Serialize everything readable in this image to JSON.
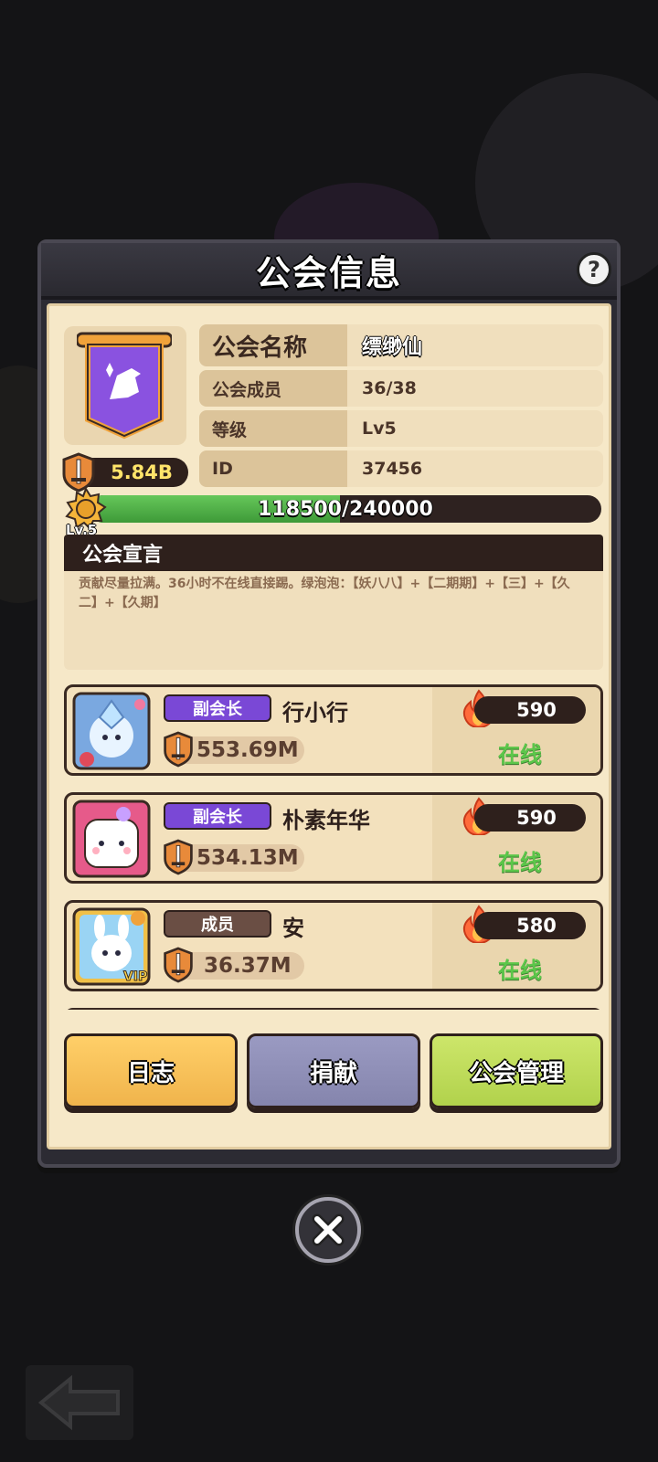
{
  "dialog": {
    "title": "公会信息",
    "help_icon": "help-icon",
    "help_label": "?"
  },
  "guild": {
    "power": "5.84B",
    "fields": [
      {
        "label": "公会名称",
        "value": "缥缈仙"
      },
      {
        "label": "公会成员",
        "value": "36/38"
      },
      {
        "label": "等级",
        "value": "Lv5"
      },
      {
        "label": "ID",
        "value": "37456"
      }
    ],
    "xp_text": "118500/240000",
    "xp_progress": 0.49,
    "level_badge": "Lv.5"
  },
  "declaration": {
    "header": "公会宣言",
    "text": "贡献尽量拉满。36小时不在线直接踢。绿泡泡：【妖八八】+【二期期】+【三】+【久二】+【久期】"
  },
  "members": [
    {
      "role": "副会长",
      "role_type": "vice",
      "name": "行小行",
      "power": "553.69M",
      "activity": "590",
      "status": "在线",
      "avatar_icon": "ice-crystal-avatar-icon",
      "vip": false
    },
    {
      "role": "副会长",
      "role_type": "vice",
      "name": "朴素年华",
      "power": "534.13M",
      "activity": "590",
      "status": "在线",
      "avatar_icon": "marshmallow-avatar-icon",
      "vip": false
    },
    {
      "role": "成员",
      "role_type": "member",
      "name": "安",
      "power": "36.37M",
      "activity": "580",
      "status": "在线",
      "avatar_icon": "bunny-avatar-icon",
      "vip": true,
      "vip_label": "VIP"
    }
  ],
  "buttons": {
    "log": "日志",
    "donate": "捐献",
    "manage": "公会管理"
  },
  "colors": {
    "vice_role": "#7a48d6",
    "member_role": "#6a4e44",
    "online": "#5cc64a",
    "xp_fill": "#4fae45"
  }
}
